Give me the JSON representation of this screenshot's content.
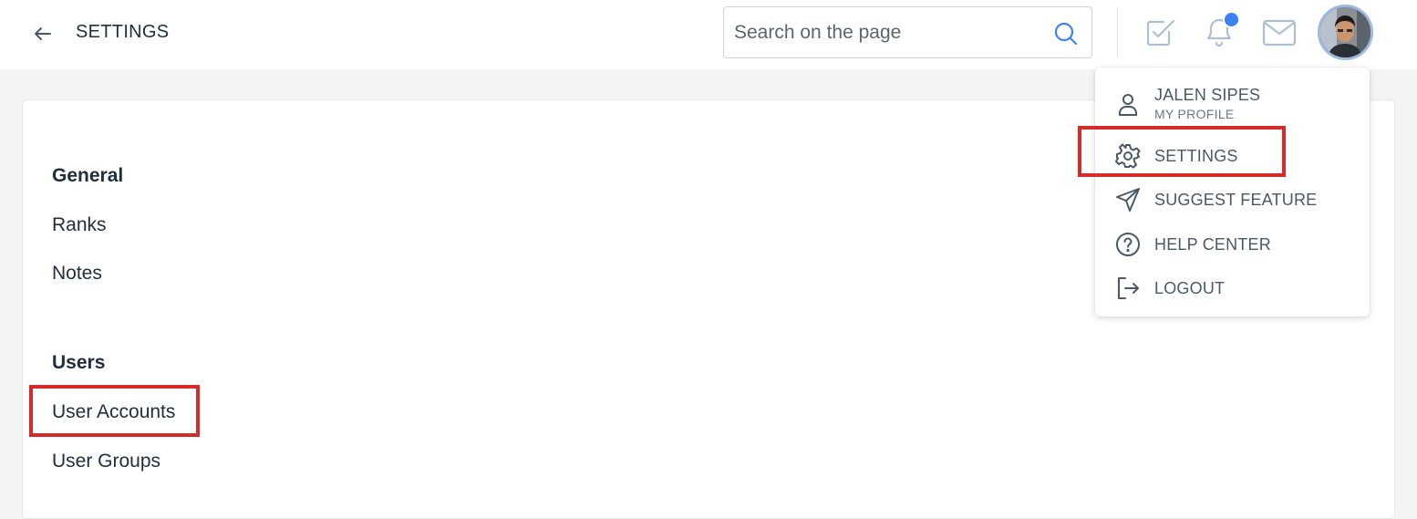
{
  "header": {
    "title": "SETTINGS",
    "back_icon": "arrow-left-icon",
    "search_placeholder": "Search on the page",
    "search_value": "",
    "icons": [
      "tasks-check-icon",
      "bell-icon",
      "mail-icon"
    ],
    "notification_badge_color": "#3b82f6"
  },
  "sections": [
    {
      "heading": "General",
      "links": [
        "Ranks",
        "Notes"
      ]
    },
    {
      "heading": "Users",
      "links": [
        "User Accounts",
        "User Groups"
      ]
    }
  ],
  "profile_menu": {
    "user_name": "JALEN SIPES",
    "user_subtitle": "MY PROFILE",
    "items": [
      {
        "label": "SETTINGS",
        "icon": "gear-icon"
      },
      {
        "label": "SUGGEST FEATURE",
        "icon": "paper-plane-icon"
      },
      {
        "label": "HELP CENTER",
        "icon": "question-circle-icon"
      },
      {
        "label": "LOGOUT",
        "icon": "logout-icon"
      }
    ]
  },
  "colors": {
    "highlight": "#d52b2b",
    "accent": "#3b82f6",
    "text": "#1f2d3d",
    "muted": "#4a5868"
  }
}
